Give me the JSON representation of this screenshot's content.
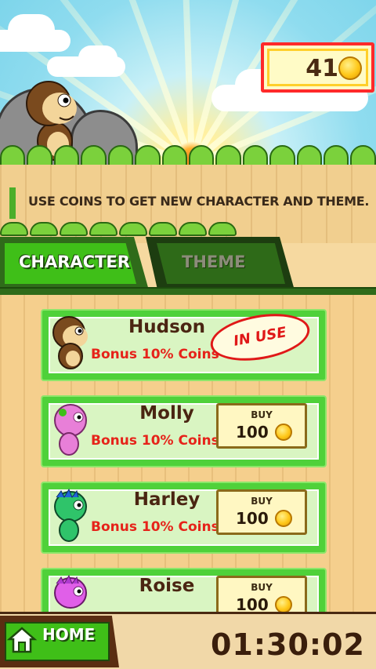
{
  "header": {
    "coins": "41",
    "coin_icon": "gold-coin-icon"
  },
  "message": "USE COINS TO GET NEW CHARACTER AND THEME.",
  "tabs": [
    {
      "label": "CHARACTER",
      "active": true
    },
    {
      "label": "THEME",
      "active": false
    }
  ],
  "characters": [
    {
      "name": "Hudson",
      "bonus": "Bonus 10% Coins",
      "status": "IN USE"
    },
    {
      "name": "Molly",
      "bonus": "Bonus 10% Coins",
      "buy_label": "BUY",
      "price": "100"
    },
    {
      "name": "Harley",
      "bonus": "Bonus 10% Coins",
      "buy_label": "BUY",
      "price": "100"
    },
    {
      "name": "Roise",
      "buy_label": "BUY",
      "price": "100"
    }
  ],
  "footer": {
    "home_label": "HOME",
    "timer": "01:30:02"
  },
  "colors": {
    "accent_green": "#3fbf18",
    "bonus_red": "#e6231a",
    "coinbox_border": "#ff2a2a"
  }
}
